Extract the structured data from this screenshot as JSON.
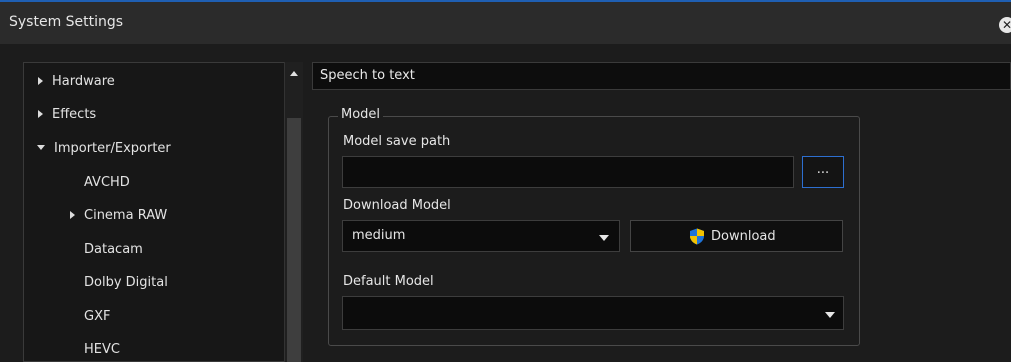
{
  "window": {
    "title": "System Settings",
    "close_glyph": "✕"
  },
  "tree": {
    "items": [
      {
        "label": "Hardware",
        "state": "collapsed"
      },
      {
        "label": "Effects",
        "state": "collapsed"
      },
      {
        "label": "Importer/Exporter",
        "state": "expanded"
      },
      {
        "label": "AVCHD",
        "state": "leaf"
      },
      {
        "label": "Cinema RAW",
        "state": "collapsed"
      },
      {
        "label": "Datacam",
        "state": "leaf"
      },
      {
        "label": "Dolby Digital",
        "state": "leaf"
      },
      {
        "label": "GXF",
        "state": "leaf"
      },
      {
        "label": "HEVC",
        "state": "leaf"
      }
    ]
  },
  "section": {
    "title": "Speech to text"
  },
  "model": {
    "group_title": "Model",
    "save_path_label": "Model save path",
    "save_path_value": "",
    "browse_label": "...",
    "download_label": "Download Model",
    "download_selected": "medium",
    "download_button": "Download",
    "default_label": "Default Model",
    "default_selected": ""
  },
  "icons": {
    "download": "shield-icon",
    "close": "close-icon"
  },
  "colors": {
    "accent": "#2d6fd0",
    "shield_blue": "#1e73d8",
    "shield_yellow": "#f2c200"
  }
}
